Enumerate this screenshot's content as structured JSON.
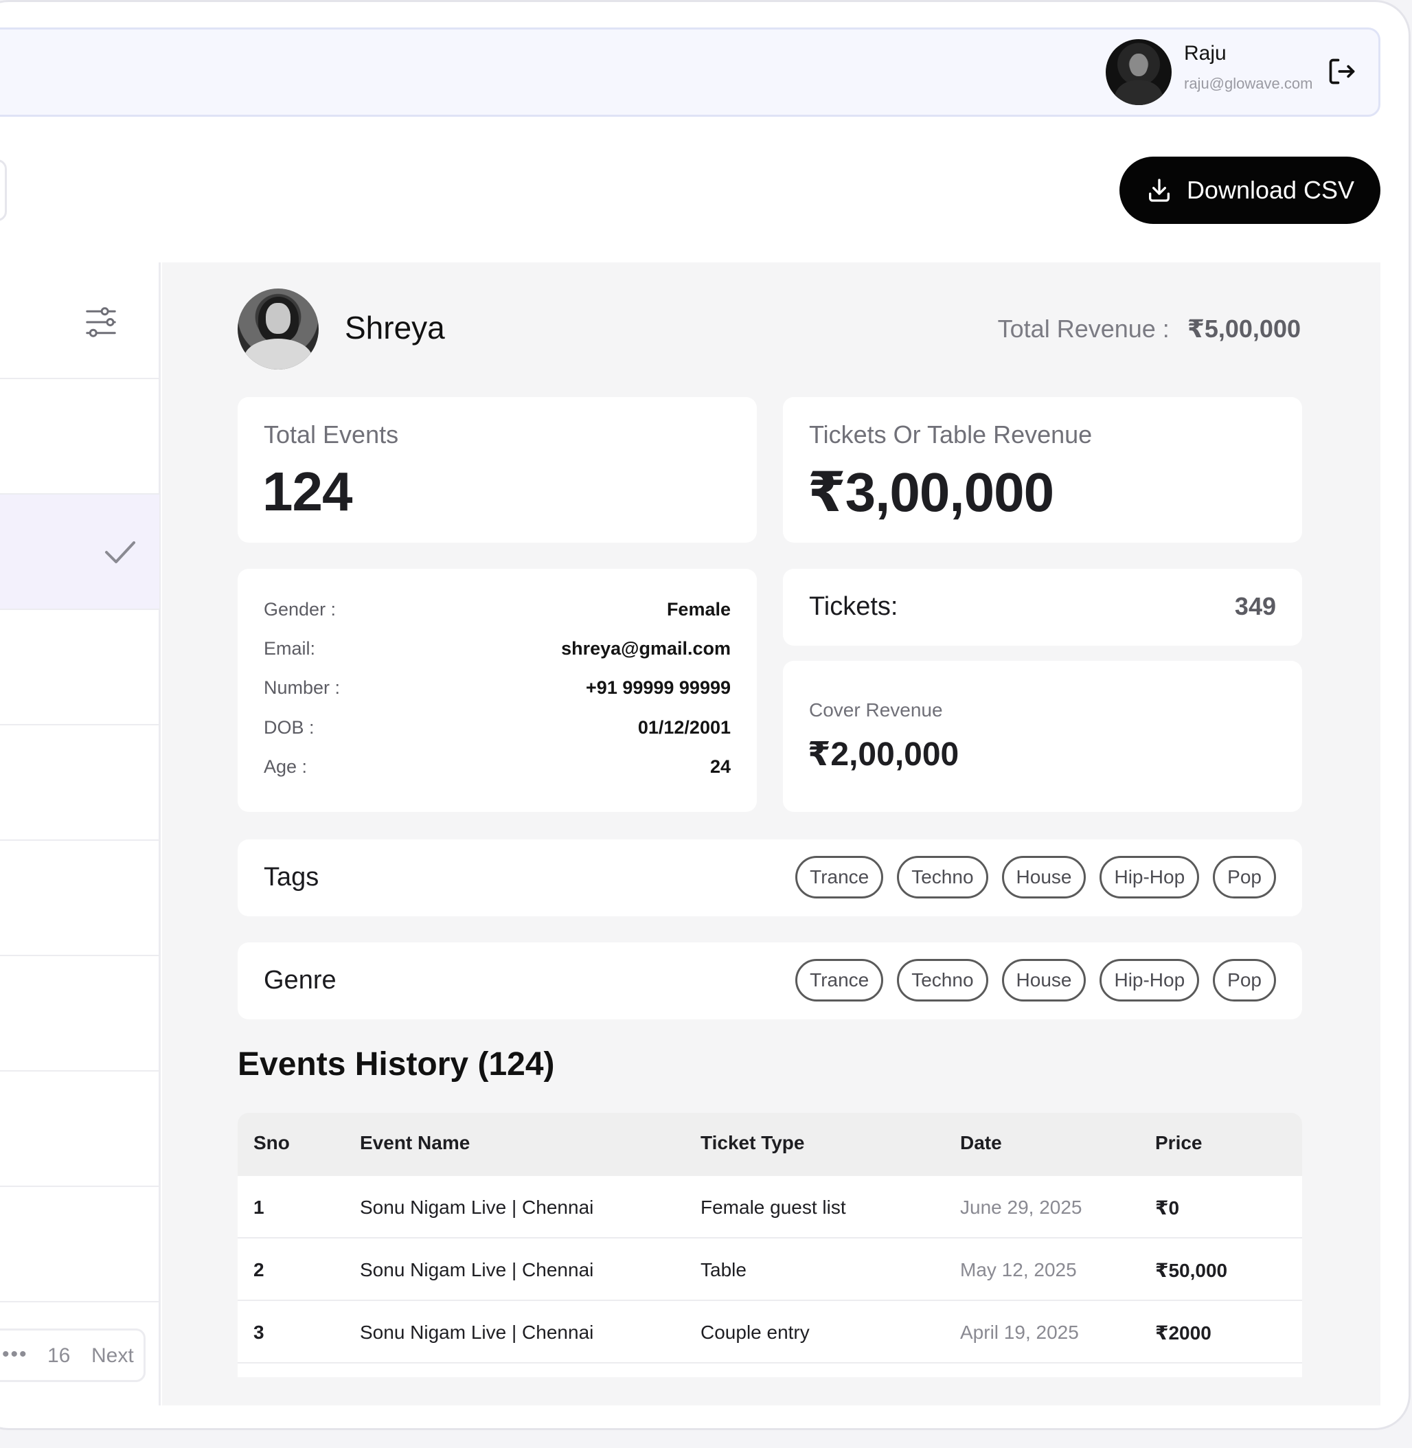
{
  "header": {
    "user_name": "Raju",
    "user_email": "raju@glowave.com"
  },
  "toolbar": {
    "download_label": "Download CSV"
  },
  "pagination": {
    "ellipsis": "•••",
    "last_page": "16",
    "next_label": "Next"
  },
  "profile": {
    "name": "Shreya",
    "total_revenue_label": "Total Revenue :",
    "total_revenue_value": "₹5,00,000"
  },
  "stats": {
    "total_events_label": "Total Events",
    "total_events_value": "124",
    "tickets_table_revenue_label": "Tickets Or Table Revenue",
    "tickets_table_revenue_value": "₹3,00,000",
    "tickets_label": "Tickets:",
    "tickets_value": "349",
    "cover_revenue_label": "Cover Revenue",
    "cover_revenue_value": "₹2,00,000"
  },
  "details": [
    {
      "label": "Gender :",
      "value": "Female"
    },
    {
      "label": "Email:",
      "value": "shreya@gmail.com"
    },
    {
      "label": "Number :",
      "value": "+91 99999 99999"
    },
    {
      "label": "DOB :",
      "value": "01/12/2001"
    },
    {
      "label": "Age :",
      "value": "24"
    }
  ],
  "tags": {
    "label": "Tags",
    "items": [
      "Trance",
      "Techno",
      "House",
      "Hip-Hop",
      "Pop"
    ]
  },
  "genre": {
    "label": "Genre",
    "items": [
      "Trance",
      "Techno",
      "House",
      "Hip-Hop",
      "Pop"
    ]
  },
  "history": {
    "title": "Events History (124)",
    "columns": [
      "Sno",
      "Event Name",
      "Ticket Type",
      "Date",
      "Price"
    ],
    "rows": [
      {
        "sno": "1",
        "event": "Sonu Nigam Live | Chennai",
        "type": "Female guest list",
        "date": "June 29, 2025",
        "price": "₹0"
      },
      {
        "sno": "2",
        "event": "Sonu Nigam Live | Chennai",
        "type": "Table",
        "date": "May 12, 2025",
        "price": "₹50,000"
      },
      {
        "sno": "3",
        "event": "Sonu Nigam Live | Chennai",
        "type": "Couple entry",
        "date": "April 19, 2025",
        "price": "₹2000"
      }
    ]
  },
  "icons": {
    "logout": "logout-icon",
    "download": "download-icon",
    "filter": "filter-icon",
    "check": "check-icon"
  }
}
